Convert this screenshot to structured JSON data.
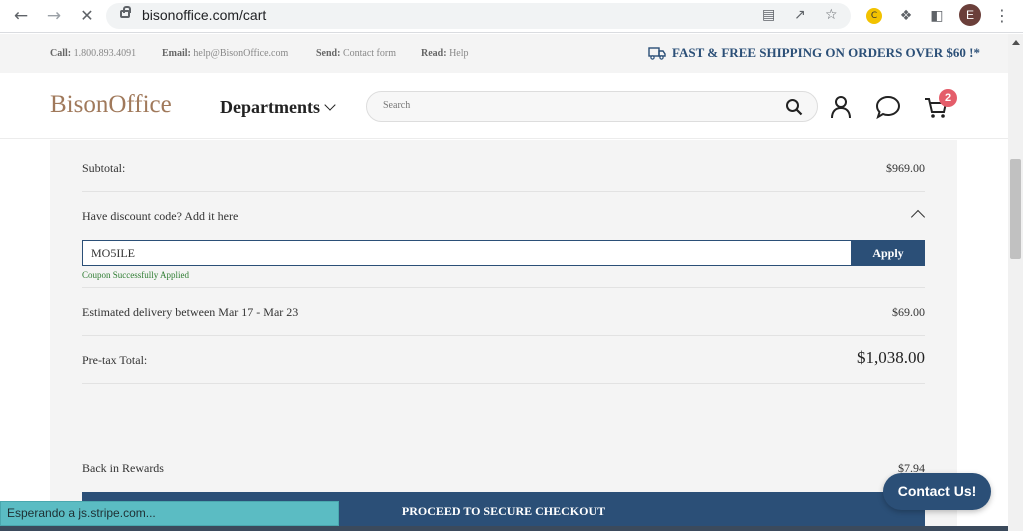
{
  "browser": {
    "url": "bisonoffice.com/cart",
    "profile_initial": "E",
    "status_text": "Esperando a js.stripe.com..."
  },
  "infobar": {
    "call_label": "Call:",
    "call_value": "1.800.893.4091",
    "email_label": "Email:",
    "email_value": "help@BisonOffice.com",
    "send_label": "Send:",
    "send_value": "Contact form",
    "read_label": "Read:",
    "read_value": "Help",
    "shipping_text": "FAST & FREE SHIPPING ON ORDERS OVER $60 !*"
  },
  "header": {
    "logo": "BisonOffice",
    "departments_label": "Departments",
    "search_placeholder": "Search",
    "cart_count": "2"
  },
  "summary": {
    "subtotal_label": "Subtotal:",
    "subtotal_value": "$969.00",
    "discount_label": "Have discount code? Add it here",
    "coupon_value": "MO5ILE",
    "apply_label": "Apply",
    "coupon_message": "Coupon Successfully Applied",
    "delivery_label": "Estimated delivery between Mar 17 - Mar 23",
    "delivery_value": "$69.00",
    "pretax_label": "Pre-tax Total:",
    "pretax_value": "$1,038.00",
    "rewards_label": "Back in Rewards",
    "rewards_value": "$7.94",
    "checkout_label": "PROCEED TO SECURE CHECKOUT"
  },
  "contact_button": "Contact Us!",
  "colors": {
    "brand_blue": "#2b4f77",
    "logo_brown": "#a0795b",
    "success_green": "#2e7d32",
    "badge_red": "#e45d6a"
  },
  "icons": [
    "back-icon",
    "forward-icon",
    "stop-loading-icon",
    "lock-icon",
    "translate-icon",
    "share-icon",
    "star-icon",
    "extension-icon",
    "puzzle-icon",
    "sidebar-icon",
    "menu-icon",
    "truck-icon",
    "search-icon",
    "user-icon",
    "chat-icon",
    "cart-icon",
    "chevron-up-icon"
  ]
}
